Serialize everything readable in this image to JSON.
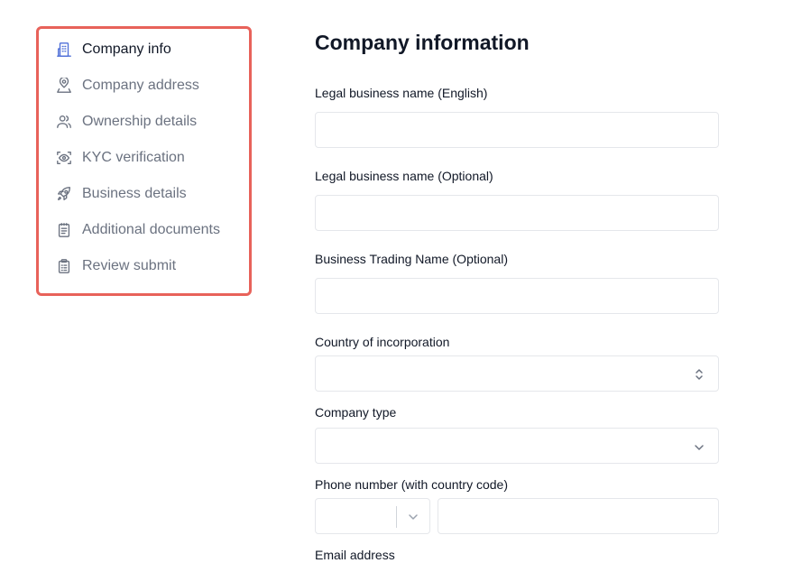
{
  "sidebar": {
    "items": [
      {
        "label": "Company info",
        "icon": "building-icon",
        "active": true
      },
      {
        "label": "Company address",
        "icon": "location-pin-icon",
        "active": false
      },
      {
        "label": "Ownership details",
        "icon": "users-icon",
        "active": false
      },
      {
        "label": "KYC verification",
        "icon": "eye-scan-icon",
        "active": false
      },
      {
        "label": "Business details",
        "icon": "rocket-icon",
        "active": false
      },
      {
        "label": "Additional documents",
        "icon": "document-list-icon",
        "active": false
      },
      {
        "label": "Review submit",
        "icon": "clipboard-check-icon",
        "active": false
      }
    ]
  },
  "form": {
    "title": "Company information",
    "legal_name_en_label": "Legal business name (English)",
    "legal_name_en_value": "",
    "legal_name_opt_label": "Legal business name (Optional)",
    "legal_name_opt_value": "",
    "trading_name_label": "Business Trading Name (Optional)",
    "trading_name_value": "",
    "country_label": "Country of incorporation",
    "country_value": "",
    "company_type_label": "Company type",
    "company_type_value": "",
    "phone_label": "Phone number (with country code)",
    "phone_code_value": "",
    "phone_number_value": "",
    "email_label": "Email address"
  },
  "colors": {
    "highlight_border": "#e8625a",
    "active_icon": "#4f6fd8",
    "muted_text": "#6b7280"
  }
}
